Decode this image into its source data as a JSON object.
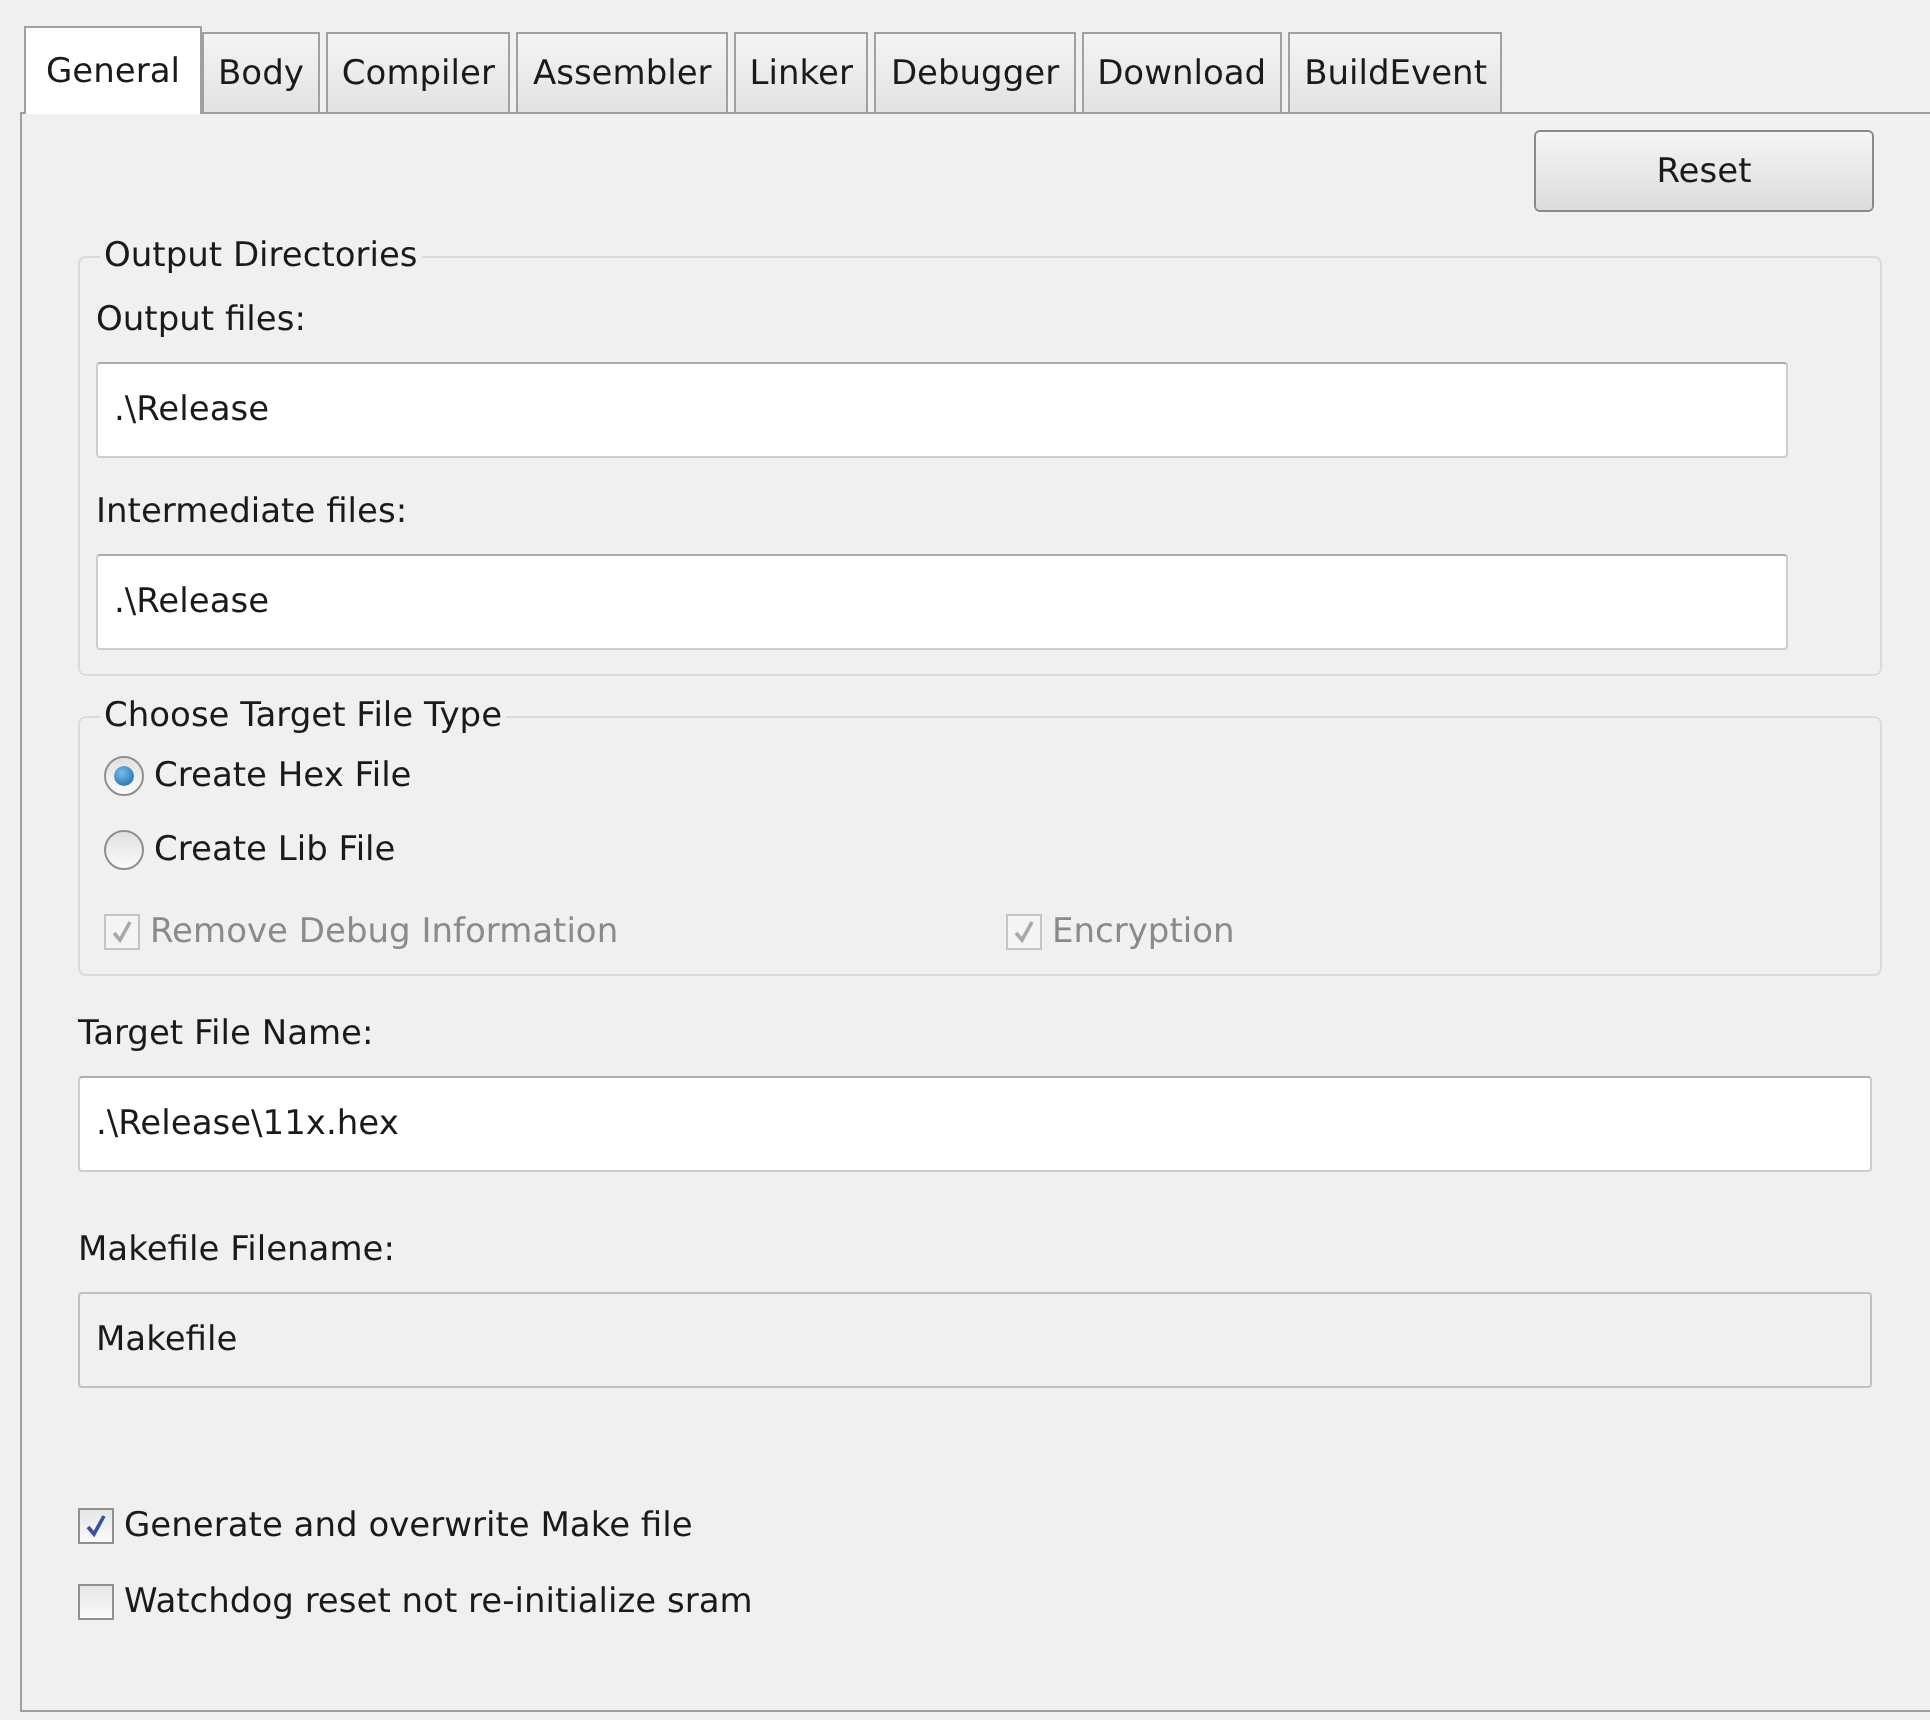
{
  "tabs": [
    {
      "label": "General",
      "selected": true
    },
    {
      "label": "Body",
      "selected": false
    },
    {
      "label": "Compiler",
      "selected": false
    },
    {
      "label": "Assembler",
      "selected": false
    },
    {
      "label": "Linker",
      "selected": false
    },
    {
      "label": "Debugger",
      "selected": false
    },
    {
      "label": "Download",
      "selected": false
    },
    {
      "label": "BuildEvent",
      "selected": false
    }
  ],
  "reset_button": "Reset",
  "output_directories": {
    "title": "Output Directories",
    "fields": [
      {
        "label": "Output files:",
        "value": ".\\Release"
      },
      {
        "label": "Intermediate files:",
        "value": ".\\Release"
      }
    ]
  },
  "target_file_type": {
    "title": "Choose Target File Type",
    "options": [
      {
        "label": "Create Hex File",
        "selected": true
      },
      {
        "label": "Create Lib File",
        "selected": false
      }
    ],
    "checks": [
      {
        "label": "Remove Debug Information",
        "checked": true,
        "disabled": true
      },
      {
        "label": "Encryption",
        "checked": true,
        "disabled": true
      }
    ]
  },
  "target_file_name": {
    "label": "Target File Name:",
    "value": ".\\Release\\11x.hex",
    "disabled": false
  },
  "makefile_filename": {
    "label": "Makefile Filename:",
    "value": "Makefile",
    "disabled": true
  },
  "options": [
    {
      "label": "Generate and overwrite Make file",
      "checked": true,
      "disabled": false
    },
    {
      "label": "Watchdog reset not re-initialize sram",
      "checked": false,
      "disabled": false
    }
  ]
}
